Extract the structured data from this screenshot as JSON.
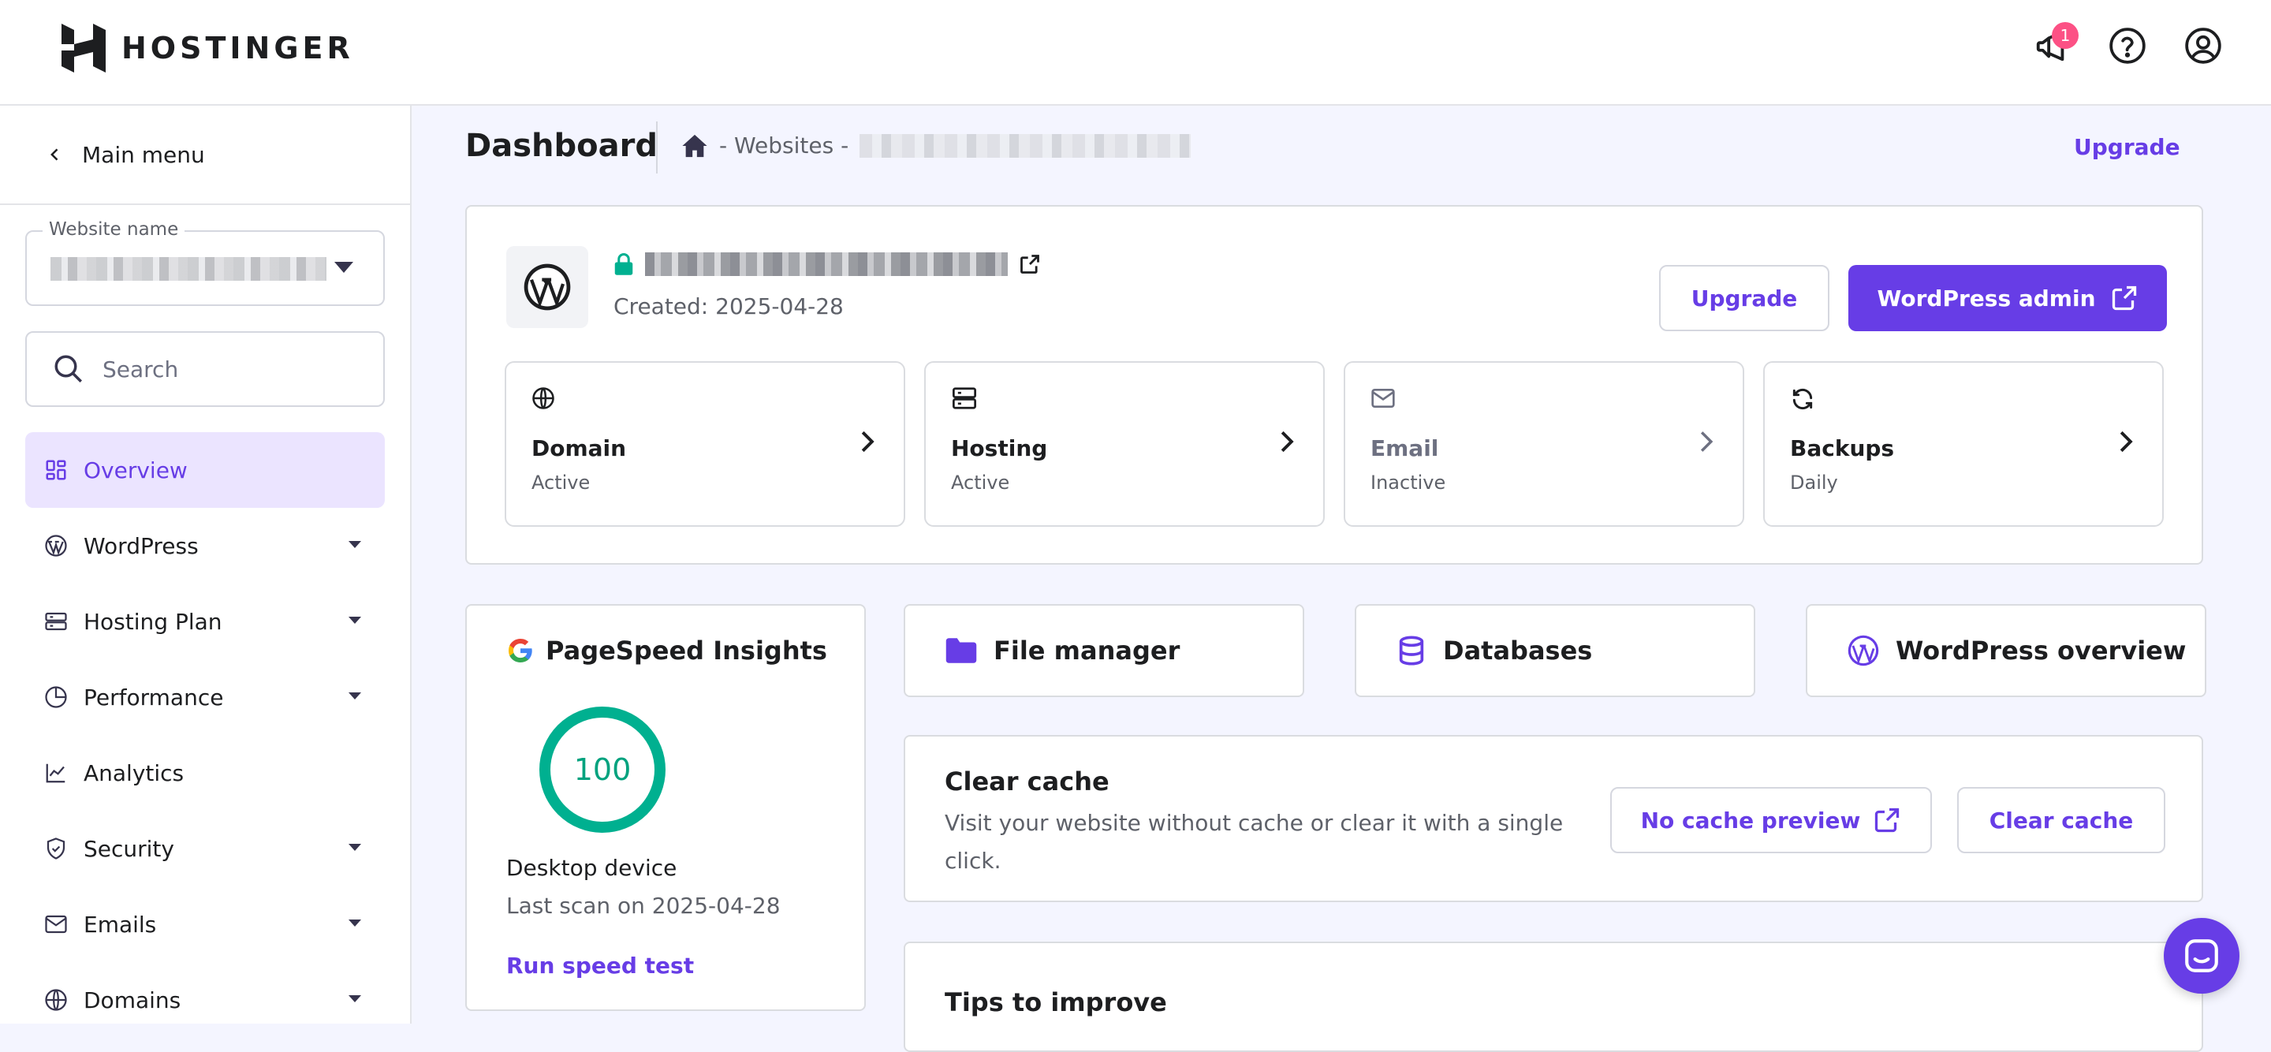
{
  "brand": {
    "name": "HOSTINGER"
  },
  "topbar": {
    "notification_count": "1"
  },
  "sidebar": {
    "main_menu": "Main menu",
    "website_name_label": "Website name",
    "search_placeholder": "Search",
    "items": [
      {
        "label": "Overview",
        "icon": "overview-icon",
        "active": true
      },
      {
        "label": "WordPress",
        "icon": "wordpress-icon",
        "expandable": true
      },
      {
        "label": "Hosting Plan",
        "icon": "server-icon",
        "expandable": true
      },
      {
        "label": "Performance",
        "icon": "pie-chart-icon",
        "expandable": true
      },
      {
        "label": "Analytics",
        "icon": "trend-chart-icon",
        "expandable": false
      },
      {
        "label": "Security",
        "icon": "shield-icon",
        "expandable": true
      },
      {
        "label": "Emails",
        "icon": "mail-icon",
        "expandable": true
      },
      {
        "label": "Domains",
        "icon": "globe-icon",
        "expandable": true
      }
    ]
  },
  "header": {
    "title": "Dashboard",
    "breadcrumb": "- Websites -",
    "upgrade": "Upgrade"
  },
  "site": {
    "created": "Created: 2025-04-28",
    "upgrade_button": "Upgrade",
    "wp_admin_button": "WordPress admin",
    "tiles": [
      {
        "title": "Domain",
        "status": "Active"
      },
      {
        "title": "Hosting",
        "status": "Active"
      },
      {
        "title": "Email",
        "status": "Inactive"
      },
      {
        "title": "Backups",
        "status": "Daily"
      }
    ]
  },
  "pagespeed": {
    "title": "PageSpeed Insights",
    "score": "100",
    "device": "Desktop device",
    "last_scan": "Last scan on 2025-04-28",
    "run": "Run speed test"
  },
  "quick_links": {
    "file_manager": "File manager",
    "databases": "Databases",
    "wp_overview": "WordPress overview"
  },
  "cache": {
    "title": "Clear cache",
    "description": "Visit your website without cache or clear it with a single click.",
    "preview_button": "No cache preview",
    "clear_button": "Clear cache"
  },
  "tips": {
    "title": "Tips to improve"
  },
  "colors": {
    "accent": "#673de6",
    "success": "#00b090",
    "badge": "#fc5185"
  }
}
